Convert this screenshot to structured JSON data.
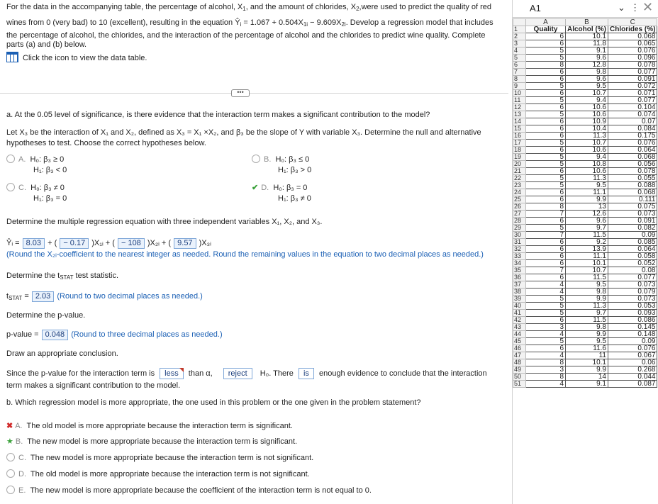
{
  "problem": {
    "intro_line1": "For the data in the accompanying table, the percentage of alcohol, X",
    "intro_line1_b": ", and the amount of chlorides, X",
    "intro_line1_c": ",were used to predict the quality of red",
    "intro_line2": "wines from 0 (very bad) to 10 (excellent), resulting in the equation Ŷ",
    "intro_line2_b": " = 1.067 + 0.504X",
    "intro_line2_c": " − 9.609X",
    "intro_line2_d": ". Develop a regression model that includes",
    "intro_line3": "the percentage of alcohol, the chlorides, and the interaction of the percentage of alcohol and the chlorides to predict wine quality. Complete",
    "intro_line4": "parts (a) and (b) below.",
    "data_link": "Click the icon to view the data table."
  },
  "part_a": {
    "question": "a. At the 0.05 level of significance, is there evidence that the interaction term makes a significant contribution to the model?",
    "let_line1": "Let X₃ be the interaction of X₁ and X₂, defined as X₃ = X₁ ×X₂, and β₃ be the slope of Y with variable X₃. Determine the null and alternative",
    "let_line2": "hypotheses to test. Choose the correct hypotheses below.",
    "options": [
      {
        "letter": "A.",
        "h0": "H₀: β₃ ≥ 0",
        "h1": "H₁: β₃ < 0"
      },
      {
        "letter": "B.",
        "h0": "H₀: β₃ ≤ 0",
        "h1": "H₁: β₃ > 0"
      },
      {
        "letter": "C.",
        "h0": "H₀: β₃ ≠ 0",
        "h1": "H₁: β₃ = 0"
      },
      {
        "letter": "D.",
        "h0": "H₀: β₃ = 0",
        "h1": "H₁: β₃ ≠ 0"
      }
    ],
    "equation_prompt": "Determine the multiple regression equation with three independent variables X₁, X₂, and X₃.",
    "eq_yhat": "Ŷᵢ =",
    "b0": "8.03",
    "plus1": "+ (",
    "b1": "− 0.17",
    "x1": ")X₁ᵢ + (",
    "b2": "− 108",
    "x2": ")X₂ᵢ + (",
    "b3": "9.57",
    "x3": ")X₃ᵢ",
    "round_note": "(Round the X₂ᵢ-coefficient to the nearest integer as needed. Round the remaining values in the equation to two decimal places as needed.)",
    "tstat_prompt": "Determine the t",
    "tstat_prompt_sub": "STAT",
    "tstat_prompt_end": " test statistic.",
    "tstat_label": "t",
    "tstat_label_sub": "STAT",
    "tstat_eq": " = ",
    "tstat_value": "2.03",
    "tstat_note": "(Round to two decimal places as needed.)",
    "pvalue_prompt": "Determine the p-value.",
    "pvalue_label": "p-value = ",
    "pvalue_value": "0.048",
    "pvalue_note": "(Round to three decimal places as needed.)",
    "conclusion_prompt": "Draw an appropriate conclusion.",
    "conc_1": "Since the p-value for the interaction term is",
    "conc_less": "less",
    "conc_2": "than α,",
    "conc_reject": "reject",
    "conc_3": "H₀. There",
    "conc_is": "is",
    "conc_4": "enough evidence to conclude that the interaction",
    "conc_line2": "term makes a significant contribution to the model."
  },
  "part_b": {
    "question": "b. Which regression model is more appropriate, the one used in this problem or the one given in the problem statement?",
    "options": [
      {
        "letter": "A.",
        "text": "The old model is more appropriate because the interaction term is significant."
      },
      {
        "letter": "B.",
        "text": "The new model is more appropriate because the interaction term is significant."
      },
      {
        "letter": "C.",
        "text": "The new model is more appropriate because the interaction term is not significant."
      },
      {
        "letter": "D.",
        "text": "The old model is more appropriate because the interaction term is not significant."
      },
      {
        "letter": "E.",
        "text": "The new model is more appropriate because the coefficient of the interaction term is not equal to 0."
      }
    ]
  },
  "sheet": {
    "name_box": "A1",
    "col_headers": [
      "A",
      "B",
      "C"
    ],
    "headers": [
      "Quality",
      "Alcohol (%)",
      "Chlorides (%)"
    ],
    "rows": [
      [
        "6",
        "10.1",
        "0.068"
      ],
      [
        "6",
        "11.8",
        "0.065"
      ],
      [
        "5",
        "9.1",
        "0.076"
      ],
      [
        "5",
        "9.6",
        "0.096"
      ],
      [
        "8",
        "12.8",
        "0.078"
      ],
      [
        "6",
        "9.8",
        "0.077"
      ],
      [
        "6",
        "9.6",
        "0.091"
      ],
      [
        "5",
        "9.5",
        "0.072"
      ],
      [
        "6",
        "10.7",
        "0.071"
      ],
      [
        "5",
        "9.4",
        "0.077"
      ],
      [
        "6",
        "10.6",
        "0.104"
      ],
      [
        "5",
        "10.6",
        "0.074"
      ],
      [
        "6",
        "10.9",
        "0.07"
      ],
      [
        "6",
        "10.4",
        "0.084"
      ],
      [
        "6",
        "11.3",
        "0.175"
      ],
      [
        "5",
        "10.7",
        "0.076"
      ],
      [
        "6",
        "10.6",
        "0.064"
      ],
      [
        "5",
        "9.4",
        "0.068"
      ],
      [
        "5",
        "10.8",
        "0.056"
      ],
      [
        "6",
        "10.6",
        "0.078"
      ],
      [
        "5",
        "11.3",
        "0.055"
      ],
      [
        "5",
        "9.5",
        "0.088"
      ],
      [
        "6",
        "11.1",
        "0.068"
      ],
      [
        "6",
        "9.9",
        "0.111"
      ],
      [
        "8",
        "13",
        "0.075"
      ],
      [
        "7",
        "12.6",
        "0.073"
      ],
      [
        "6",
        "9.6",
        "0.091"
      ],
      [
        "5",
        "9.7",
        "0.082"
      ],
      [
        "7",
        "11.5",
        "0.09"
      ],
      [
        "6",
        "9.2",
        "0.085"
      ],
      [
        "6",
        "13.9",
        "0.064"
      ],
      [
        "6",
        "11.1",
        "0.058"
      ],
      [
        "6",
        "10.1",
        "0.052"
      ],
      [
        "7",
        "10.7",
        "0.08"
      ],
      [
        "6",
        "11.5",
        "0.077"
      ],
      [
        "4",
        "9.5",
        "0.073"
      ],
      [
        "4",
        "9.8",
        "0.079"
      ],
      [
        "5",
        "9.9",
        "0.073"
      ],
      [
        "5",
        "11.3",
        "0.053"
      ],
      [
        "5",
        "9.7",
        "0.093"
      ],
      [
        "6",
        "11.5",
        "0.086"
      ],
      [
        "3",
        "9.8",
        "0.145"
      ],
      [
        "4",
        "9.9",
        "0.148"
      ],
      [
        "5",
        "9.5",
        "0.09"
      ],
      [
        "6",
        "11.6",
        "0.076"
      ],
      [
        "4",
        "11",
        "0.067"
      ],
      [
        "8",
        "10.1",
        "0.06"
      ],
      [
        "3",
        "9.9",
        "0.268"
      ],
      [
        "8",
        "14",
        "0.044"
      ],
      [
        "4",
        "9.1",
        "0.087"
      ]
    ]
  }
}
